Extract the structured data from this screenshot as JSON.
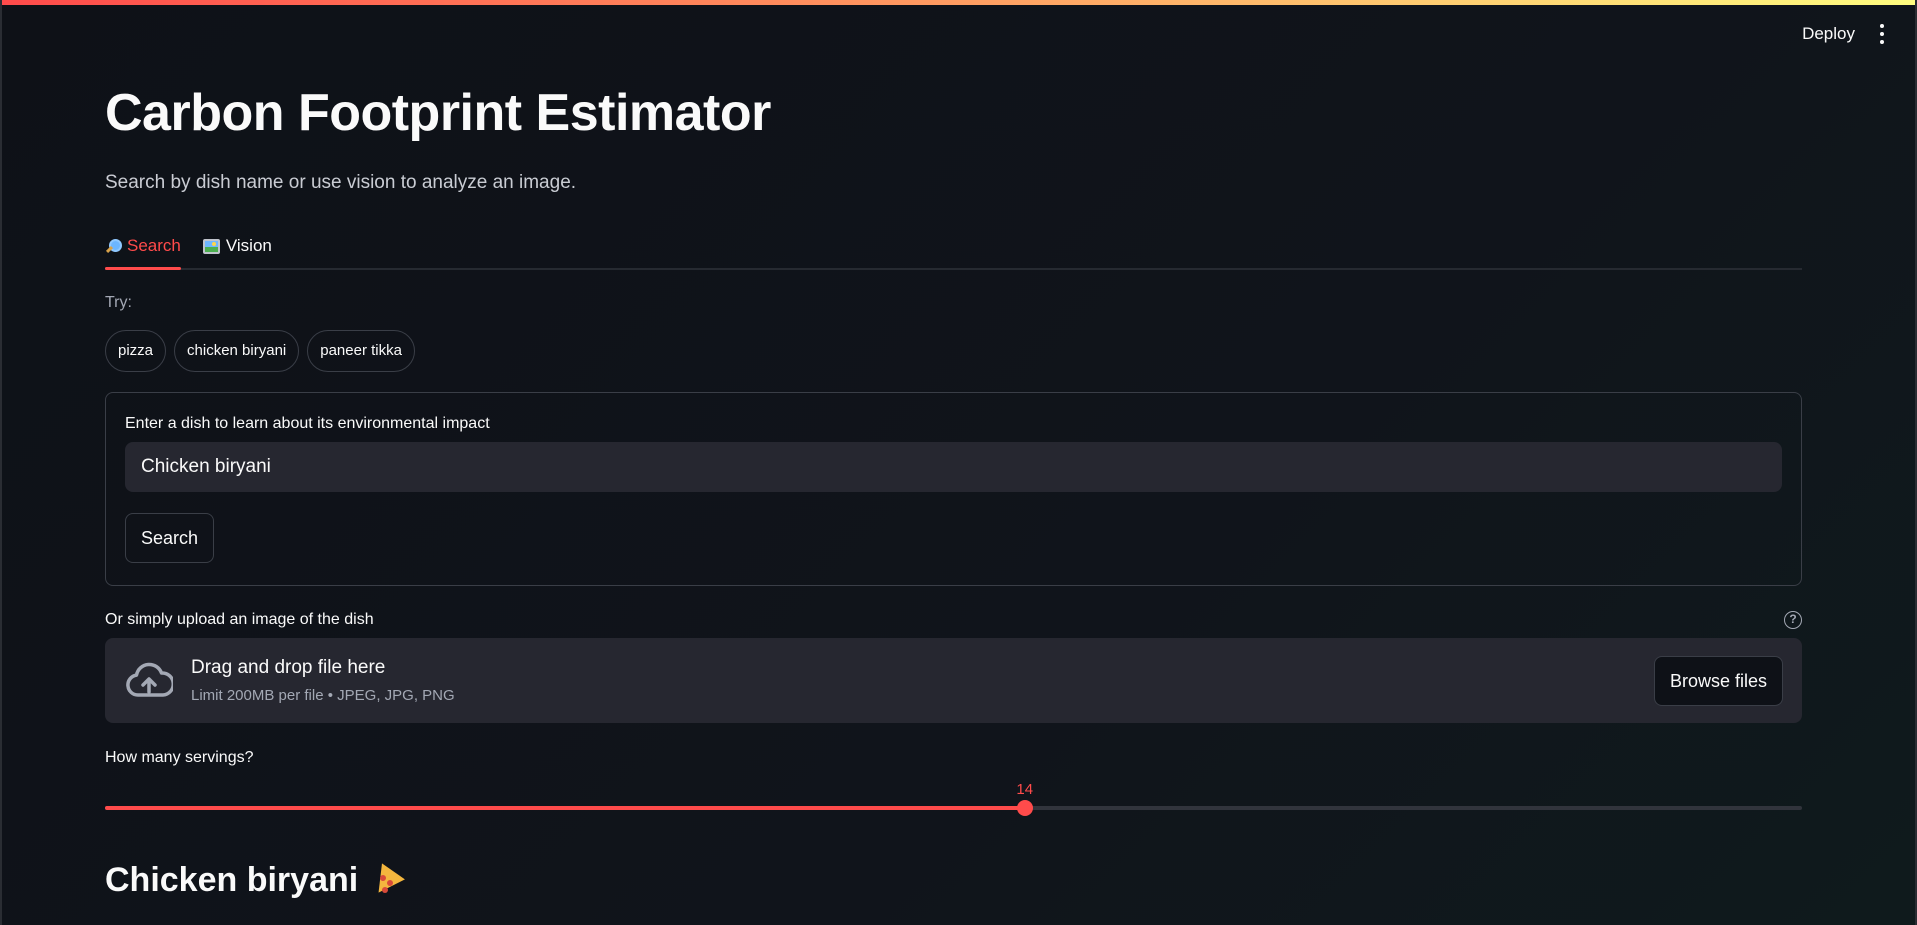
{
  "header": {
    "deploy_label": "Deploy",
    "menu_icon": "kebab-menu-icon"
  },
  "page": {
    "title": "Carbon Footprint Estimator",
    "subtitle": "Search by dish name or use vision to analyze an image."
  },
  "tabs": [
    {
      "label": "Search",
      "icon": "magnifier-icon",
      "active": true
    },
    {
      "label": "Vision",
      "icon": "picture-icon",
      "active": false
    }
  ],
  "suggestions": {
    "label": "Try:",
    "chips": [
      "pizza",
      "chicken biryani",
      "paneer tikka"
    ]
  },
  "search_form": {
    "field_label": "Enter a dish to learn about its environmental impact",
    "input_value": "Chicken biryani",
    "button_label": "Search"
  },
  "uploader": {
    "label": "Or simply upload an image of the dish",
    "drop_title": "Drag and drop file here",
    "drop_subtitle": "Limit 200MB per file • JPEG, JPG, PNG",
    "browse_label": "Browse files",
    "help_icon": "help-circle-icon",
    "upload_icon": "cloud-upload-icon"
  },
  "servings_slider": {
    "label": "How many servings?",
    "value": 14,
    "value_text": "14",
    "fraction": 0.542
  },
  "result": {
    "heading": "Chicken biryani",
    "emoji_icon": "pizza-icon"
  },
  "colors": {
    "accent": "#ff4b4b",
    "background": "#0e1117",
    "surface": "#262730"
  }
}
